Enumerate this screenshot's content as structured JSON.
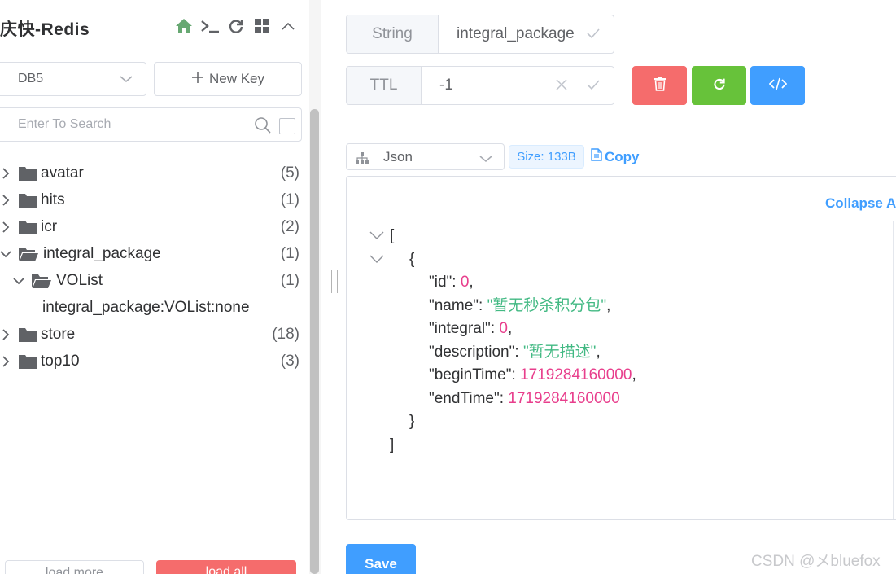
{
  "app": {
    "title": "庆快-Redis"
  },
  "toolbar_icons": [
    "home-icon",
    "terminal-icon",
    "refresh-icon",
    "grid-icon",
    "chevron-up-icon"
  ],
  "sidebar": {
    "db_select": "DB5",
    "new_key_label": "New Key",
    "search_placeholder": "Enter To Search",
    "tree": [
      {
        "label": "avatar",
        "count": "(5)",
        "expanded": false,
        "depth": 0
      },
      {
        "label": "hits",
        "count": "(1)",
        "expanded": false,
        "depth": 0
      },
      {
        "label": "icr",
        "count": "(2)",
        "expanded": false,
        "depth": 0
      },
      {
        "label": "integral_package",
        "count": "(1)",
        "expanded": true,
        "depth": 0
      },
      {
        "label": "VOList",
        "count": "(1)",
        "expanded": true,
        "depth": 1
      },
      {
        "label": "integral_package:VOList:none",
        "count": "",
        "leaf": true,
        "depth": 2
      },
      {
        "label": "store",
        "count": "(18)",
        "expanded": false,
        "depth": 0
      },
      {
        "label": "top10",
        "count": "(3)",
        "expanded": false,
        "depth": 0
      }
    ],
    "load_more_label": "load more",
    "load_all_label": "load all"
  },
  "key": {
    "type_label": "String",
    "name": "integral_package",
    "ttl_label": "TTL",
    "ttl_value": "-1"
  },
  "actions": {
    "delete_color": "#f56c6c",
    "refresh_color": "#67c23a",
    "code_color": "#409eff"
  },
  "viewer": {
    "format": "Json",
    "size_tag": "Size: 133B",
    "copy_label": "Copy",
    "collapse_all_label": "Collapse All",
    "json": {
      "open_bracket": "[",
      "open_brace": "{",
      "id_key": "\"id\"",
      "id_val": "0",
      "name_key": "\"name\"",
      "name_val": "\"暂无秒杀积分包\"",
      "integral_key": "\"integral\"",
      "integral_val": "0",
      "description_key": "\"description\"",
      "description_val": "\"暂无描述\"",
      "beginTime_key": "\"beginTime\"",
      "beginTime_val": "1719284160000",
      "endTime_key": "\"endTime\"",
      "endTime_val": "1719284160000",
      "close_brace": "}",
      "close_bracket": "]"
    },
    "save_label": "Save"
  },
  "watermark": "CSDN @メbluefox"
}
